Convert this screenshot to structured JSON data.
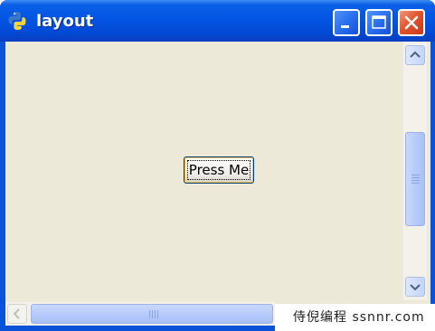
{
  "window": {
    "title": "layout",
    "app_icon": "python-icon",
    "controls": [
      "minimize",
      "maximize",
      "close"
    ]
  },
  "content": {
    "button_label": "Press Me"
  },
  "scrollbars": {
    "vertical": {
      "up": "chevron-up-icon",
      "down": "chevron-down-icon"
    },
    "horizontal": {
      "left": "chevron-left-icon"
    }
  },
  "watermark": "侍倪编程 ssnnr.com",
  "colors": {
    "titlebar": "#0355e3",
    "client_bg": "#ece9d8",
    "close_button": "#e2552f",
    "scroll_thumb": "#b4c9fa"
  }
}
